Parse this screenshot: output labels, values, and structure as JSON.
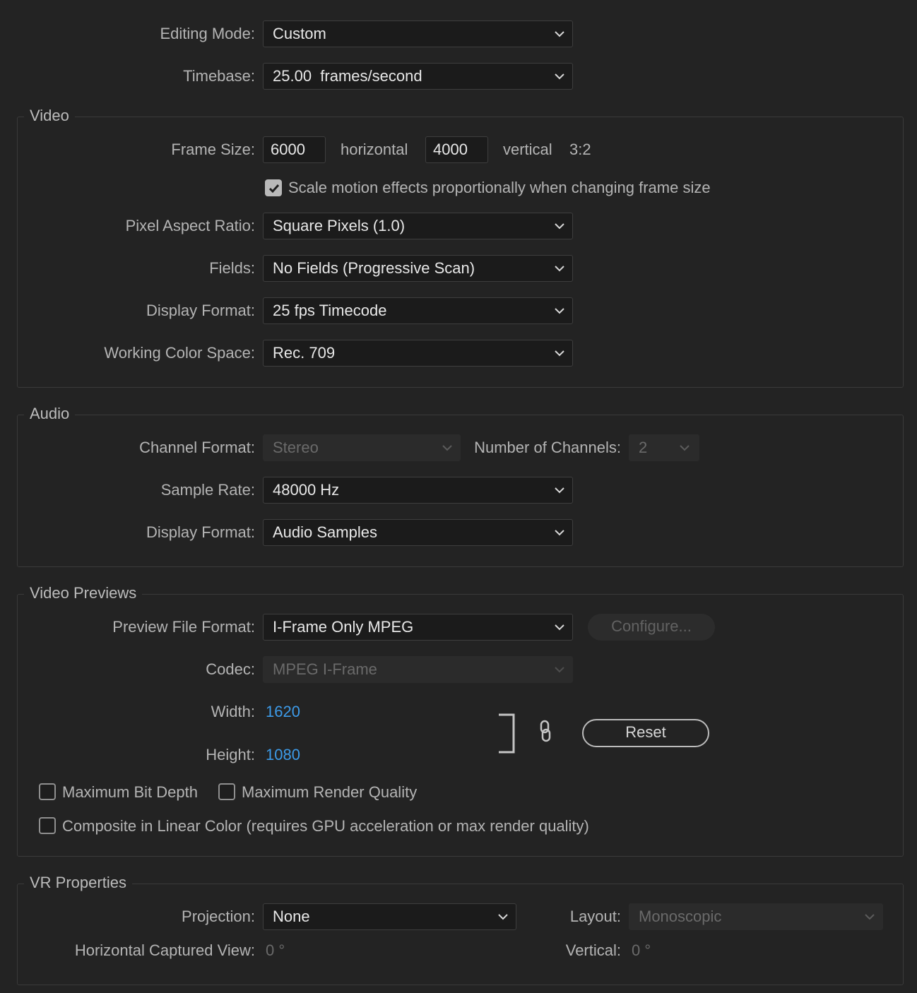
{
  "editing_mode": {
    "label": "Editing Mode:",
    "value": "Custom"
  },
  "timebase": {
    "label": "Timebase:",
    "value": "25.00  frames/second"
  },
  "video": {
    "title": "Video",
    "frame_size": {
      "label": "Frame Size:",
      "width": "6000",
      "width_label": "horizontal",
      "height": "4000",
      "height_label": "vertical",
      "aspect": "3:2"
    },
    "scale_motion": {
      "label": "Scale motion effects proportionally when changing frame size",
      "checked": true
    },
    "pixel_aspect_ratio": {
      "label": "Pixel Aspect Ratio:",
      "value": "Square Pixels (1.0)"
    },
    "fields": {
      "label": "Fields:",
      "value": "No Fields (Progressive Scan)"
    },
    "display_format": {
      "label": "Display Format:",
      "value": "25 fps Timecode"
    },
    "working_color_space": {
      "label": "Working Color Space:",
      "value": "Rec. 709"
    }
  },
  "audio": {
    "title": "Audio",
    "channel_format": {
      "label": "Channel Format:",
      "value": "Stereo"
    },
    "number_of_channels": {
      "label": "Number of Channels:",
      "value": "2"
    },
    "sample_rate": {
      "label": "Sample Rate:",
      "value": "48000 Hz"
    },
    "display_format": {
      "label": "Display Format:",
      "value": "Audio Samples"
    }
  },
  "video_previews": {
    "title": "Video Previews",
    "preview_file_format": {
      "label": "Preview File Format:",
      "value": "I-Frame Only MPEG"
    },
    "configure_label": "Configure...",
    "codec": {
      "label": "Codec:",
      "value": "MPEG I-Frame"
    },
    "width": {
      "label": "Width:",
      "value": "1620"
    },
    "height": {
      "label": "Height:",
      "value": "1080"
    },
    "reset_label": "Reset",
    "max_bit_depth": {
      "label": "Maximum Bit Depth",
      "checked": false
    },
    "max_render_quality": {
      "label": "Maximum Render Quality",
      "checked": false
    },
    "composite_linear": {
      "label": "Composite in Linear Color (requires GPU acceleration or max render quality)",
      "checked": false
    }
  },
  "vr_properties": {
    "title": "VR Properties",
    "projection": {
      "label": "Projection:",
      "value": "None"
    },
    "layout": {
      "label": "Layout:",
      "value": "Monoscopic"
    },
    "horizontal_captured_view": {
      "label": "Horizontal Captured View:",
      "value": "0 °"
    },
    "vertical": {
      "label": "Vertical:",
      "value": "0 °"
    }
  },
  "icons": [
    "chevron-down-icon",
    "checkmark-icon",
    "link-icon",
    "bracket-icon"
  ],
  "colors": {
    "background": "#232323",
    "field": "#1b1b1b",
    "accent_link": "#3d9be9",
    "text": "#b4b4b4"
  }
}
